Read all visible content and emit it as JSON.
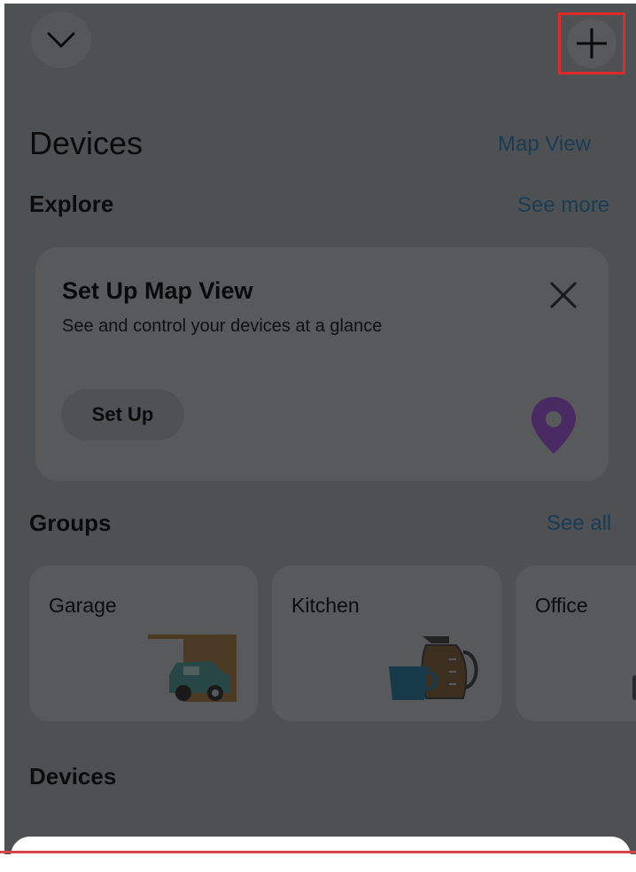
{
  "header": {
    "collapse_icon": "chevron-down-icon",
    "add_icon": "plus-icon"
  },
  "page_title": "Devices",
  "map_view_link": "Map View",
  "explore": {
    "heading": "Explore",
    "see_more": "See more",
    "card": {
      "title": "Set Up Map View",
      "subtitle": "See and control your devices at a glance",
      "button": "Set Up",
      "close_icon": "close-icon",
      "pin_icon": "location-pin-icon",
      "pin_color": "#4a2a63"
    }
  },
  "groups": {
    "heading": "Groups",
    "see_all": "See all",
    "items": [
      {
        "label": "Garage",
        "icon": "garage-car-icon"
      },
      {
        "label": "Kitchen",
        "icon": "coffee-pot-icon"
      },
      {
        "label": "Office",
        "icon": "office-icon"
      }
    ]
  },
  "devices_heading": "Devices",
  "colors": {
    "overlay": "#4e5153",
    "card": "#57595b",
    "link": "#1b3b52",
    "highlight": "#e02a2a"
  }
}
